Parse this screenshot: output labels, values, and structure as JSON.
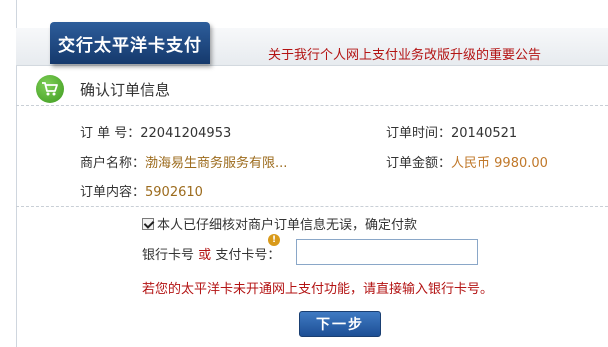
{
  "header": {
    "bank_title": "交行太平洋卡支付",
    "notice": "关于我行个人网上支付业务改版升级的重要公告"
  },
  "section": {
    "title": "确认订单信息",
    "icon": "shopping-cart-icon"
  },
  "order": {
    "order_no_label": "订 单 号：",
    "order_no": "22041204953",
    "order_time_label": "订单时间：",
    "order_time": "20140521",
    "merchant_label": "商户名称：",
    "merchant": "渤海易生商务服务有限...",
    "amount_label": "订单金额：",
    "amount": "人民币 9980.00",
    "content_label": "订单内容：",
    "content": "5902610"
  },
  "confirm": {
    "text": "本人已仔细核对商户订单信息无误，确定付款",
    "checked": true
  },
  "card": {
    "label_bank": "银行卡号",
    "label_or": "或",
    "label_pay": "支付卡号：",
    "value": ""
  },
  "warning": "若您的太平洋卡未开通网上支付功能，请直接输入银行卡号。",
  "next_button": "下一步",
  "colors": {
    "brand_blue": "#1f4a85",
    "notice_red": "#b31313",
    "amount_orange": "#c0782a"
  }
}
